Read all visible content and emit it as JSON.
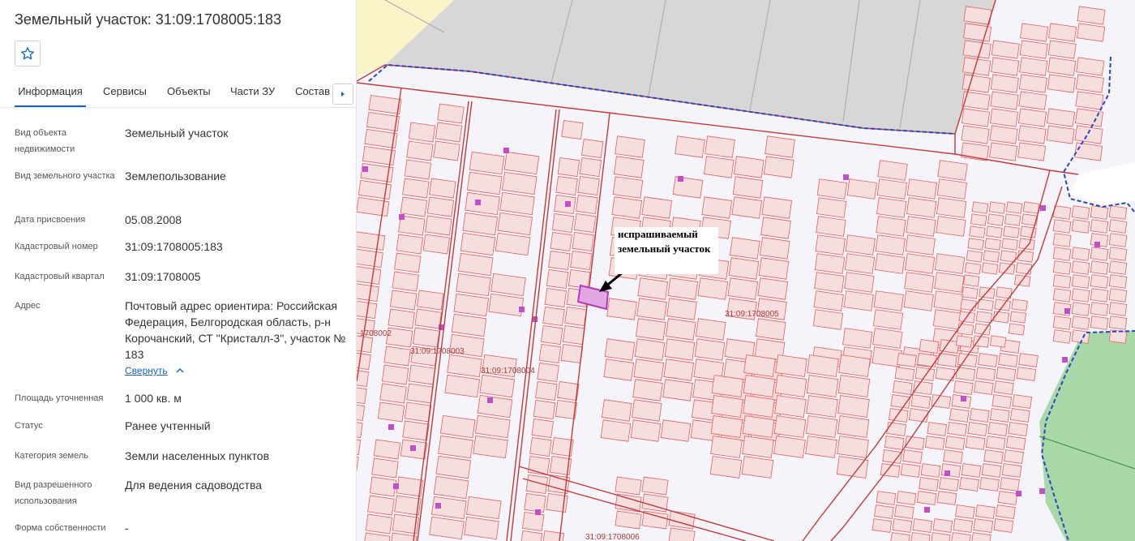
{
  "panel": {
    "title": "Земельный участок: 31:09:1708005:183",
    "favorite_icon": "star-outline-icon",
    "tabs": [
      "Информация",
      "Сервисы",
      "Объекты",
      "Части ЗУ",
      "Состав"
    ],
    "tab_more_icon": "caret-right-icon",
    "fields": [
      {
        "label": "Вид объекта недвижимости",
        "value": "Земельный участок"
      },
      {
        "label": "Вид земельного участка",
        "value": "Землепользование"
      },
      {
        "label": "Дата присвоения",
        "value": "05.08.2008"
      },
      {
        "label": "Кадастровый номер",
        "value": "31:09:1708005:183"
      },
      {
        "label": "Кадастровый квартал",
        "value": "31:09:1708005"
      },
      {
        "label": "Адрес",
        "value": "Почтовый адрес ориентира: Российская Федерация, Белгородская область, р-н Корочанский, СТ \"Кристалл-3\", участок № 183"
      },
      {
        "label": "Площадь уточненная",
        "value": "1 000 кв. м"
      },
      {
        "label": "Статус",
        "value": "Ранее учтенный"
      },
      {
        "label": "Категория земель",
        "value": "Земли населенных пунктов"
      },
      {
        "label": "Вид разрешенного использования",
        "value": "Для ведения садоводства"
      },
      {
        "label": "Форма собственности",
        "value": "-"
      }
    ],
    "collapse_link": "Свернуть",
    "collapse_icon": "chevron-up-icon"
  },
  "map": {
    "callout_text": "испрашиваемый земельный участок",
    "quarter_labels": [
      "31:09:1708005",
      "31:09:1708003",
      "31:09:1708004",
      "1708002",
      "31:09:1708006"
    ],
    "colors": {
      "background": "#f4f4fa",
      "parcel_stroke": "#e06060",
      "parcel_fill": "#f6dede",
      "quarter_line": "#c43a3a",
      "boundary_dash": "#2b45c9",
      "green_zone": "#a8d8a8",
      "grey_zone": "#d7d7d7",
      "yellow_zone": "#fbf4c8",
      "marker": "#c04fc8",
      "selected_parcel": "#b03ab8"
    }
  }
}
